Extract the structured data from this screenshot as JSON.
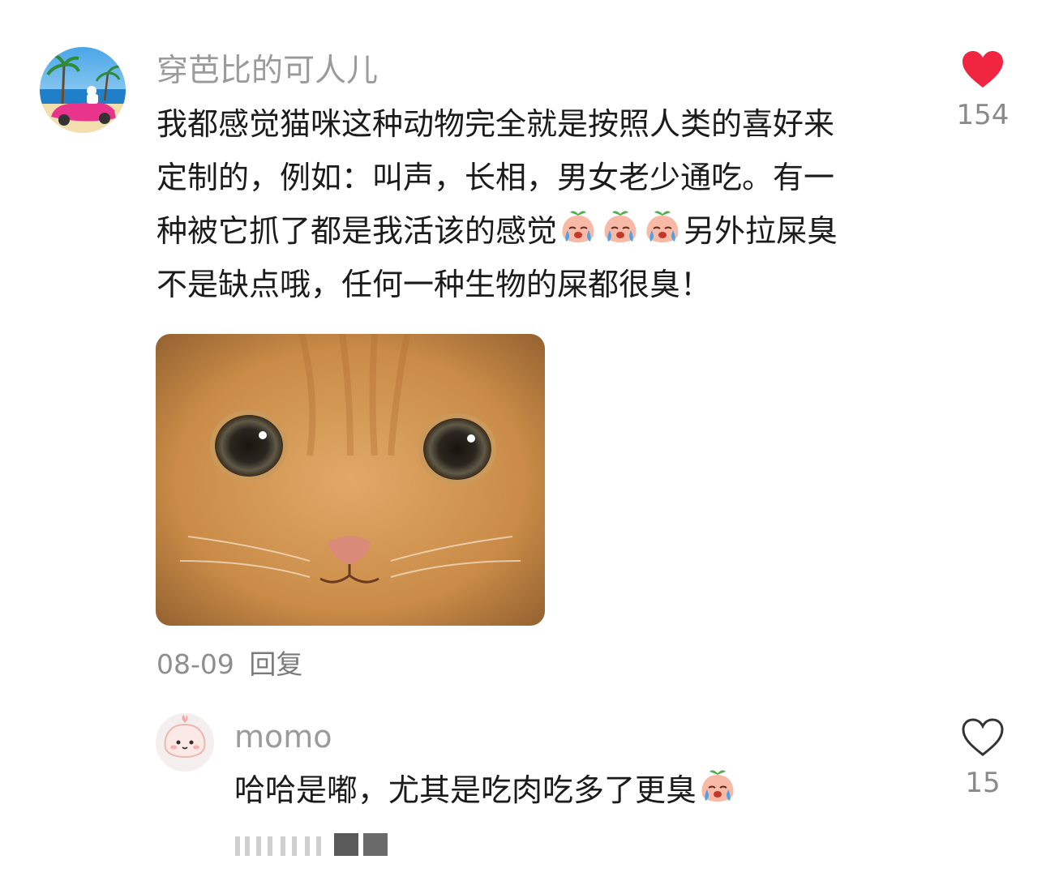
{
  "main_comment": {
    "username": "穿芭比的可人儿",
    "text_lines": [
      "我都感觉猫咪这种动物完全就是按照人类的喜好来",
      "定制的，例如：叫声，长相，男女老少通吃。有一",
      "种被它抓了都是我活该的感觉",
      "另外拉屎臭",
      "不是缺点哦，任何一种生物的屎都很臭！"
    ],
    "date": "08-09",
    "reply_label": "回复",
    "likes": "154",
    "liked": true,
    "image_description_icon": "orange-kitten-closeup-photo"
  },
  "reply_comment": {
    "username": "momo",
    "text": "哈哈是嘟，尤其是吃肉吃多了更臭",
    "likes": "15",
    "liked": false
  },
  "colors": {
    "like_active": "#f0253f",
    "secondary_text": "#9b9b9b",
    "body_text": "#1b1b1b"
  }
}
